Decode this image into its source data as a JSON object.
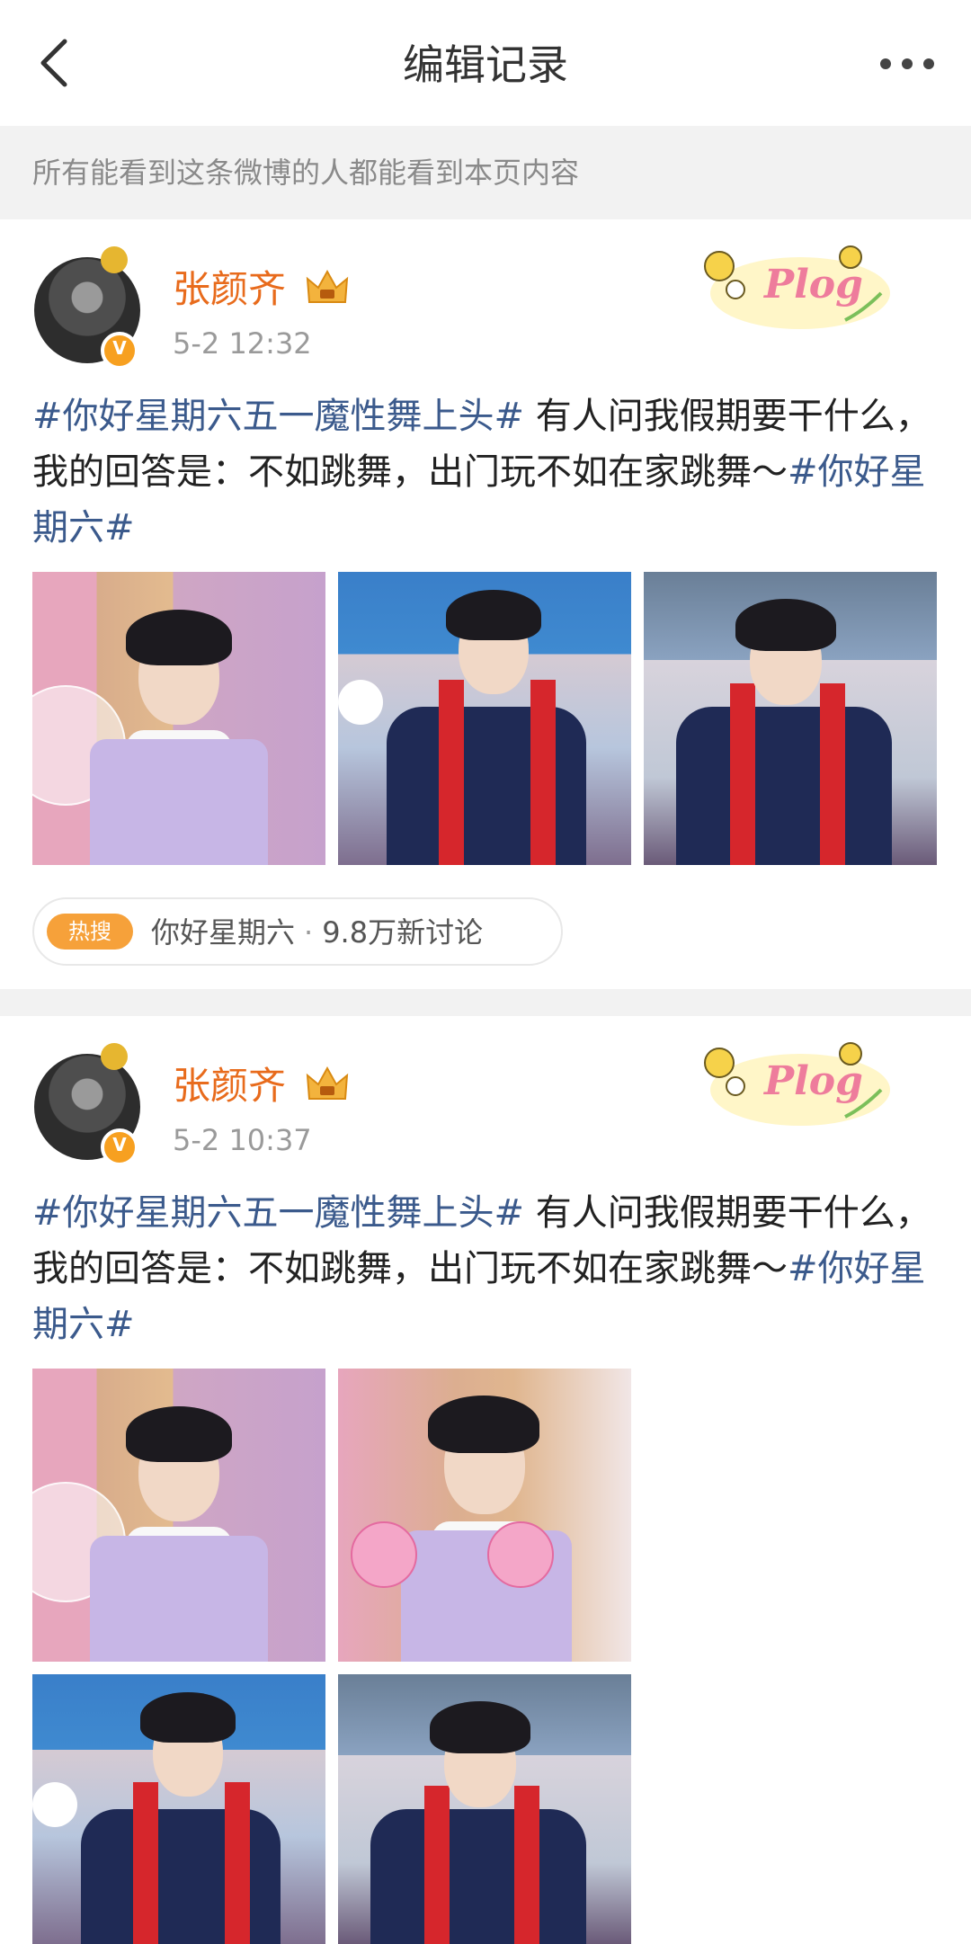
{
  "header": {
    "title": "编辑记录"
  },
  "notice": "所有能看到这条微博的人都能看到本页内容",
  "posts": [
    {
      "name": "张颜齐",
      "time": "5-2 12:32",
      "text": {
        "tag1": "#你好星期六五一魔性舞上头#",
        "body": " 有人问我假期要干什么，我的回答是：不如跳舞，出门玩不如在家跳舞～",
        "tag2": "#你好星期六#"
      },
      "hot_search": {
        "badge": "热搜",
        "topic": "你好星期六",
        "separator": "·",
        "count": "9.8万新讨论"
      }
    },
    {
      "name": "张颜齐",
      "time": "5-2 10:37",
      "text": {
        "tag1": "#你好星期六五一魔性舞上头#",
        "body": " 有人问我假期要干什么，我的回答是：不如跳舞，出门玩不如在家跳舞～",
        "tag2": "#你好星期六#"
      }
    }
  ],
  "colors": {
    "name": "#e86b1c",
    "tag": "#3b5a8c",
    "hot_badge": "#f6a13a",
    "background_gap": "#f2f2f2"
  },
  "icons": [
    "back-arrow-icon",
    "more-dots-icon",
    "verified-v-icon",
    "crown-icon",
    "plog-sticker"
  ]
}
